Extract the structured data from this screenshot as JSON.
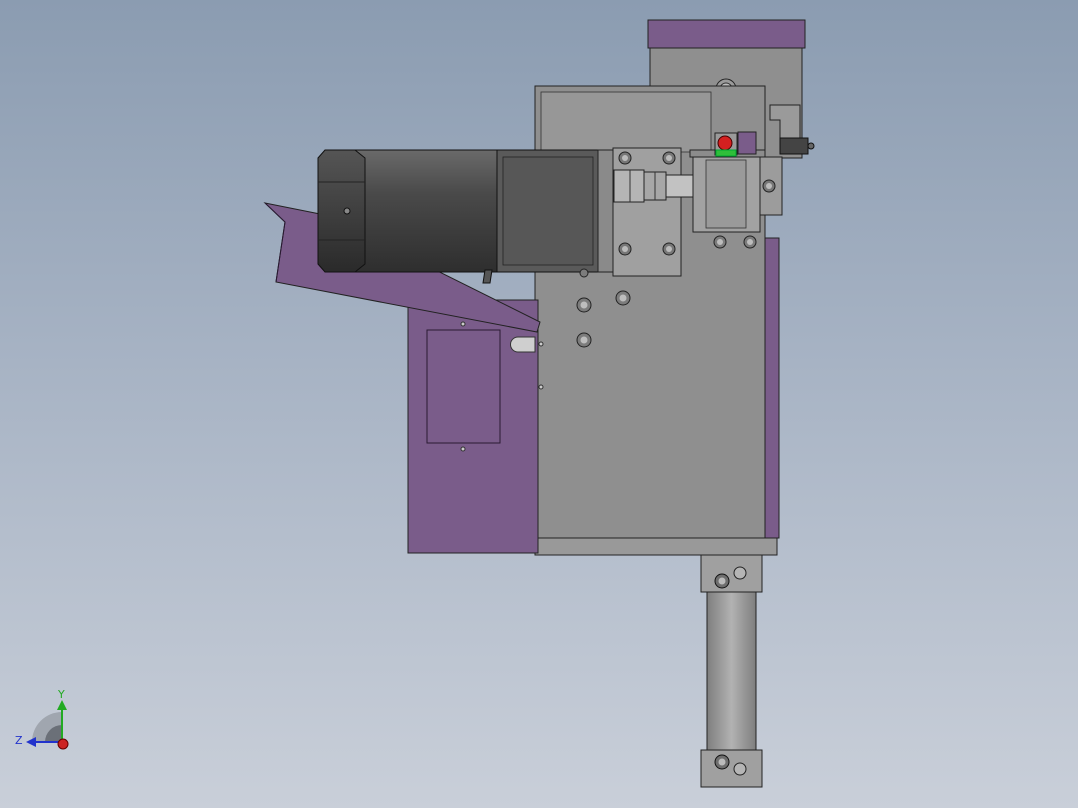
{
  "viewport": {
    "background_top": "#8b9cb1",
    "background_bottom": "#c9cfd9"
  },
  "colors": {
    "purple_sheet": "#7a5c8a",
    "purple_dark": "#5e4470",
    "plate_gray": "#8f8f8f",
    "plate_light": "#a0a0a0",
    "motor_dark": "#3f3f3f",
    "motor_mid": "#5a5a5a",
    "cylinder_gray": "#9b9b9b",
    "indicator_red": "#d42020",
    "indicator_green": "#2fbf3a",
    "axis_x": "#cc2222",
    "axis_y": "#22aa22",
    "axis_z": "#2233cc"
  },
  "triad": {
    "y_label": "Y",
    "z_label": "Z"
  },
  "parts": {
    "top_block_icon": "top-bracket",
    "motor_icon": "gear-motor",
    "stepper_icon": "stepper-motor",
    "coupling_icon": "shaft-coupling",
    "hopper_icon": "feed-hopper",
    "cylinder_icon": "air-cylinder"
  }
}
